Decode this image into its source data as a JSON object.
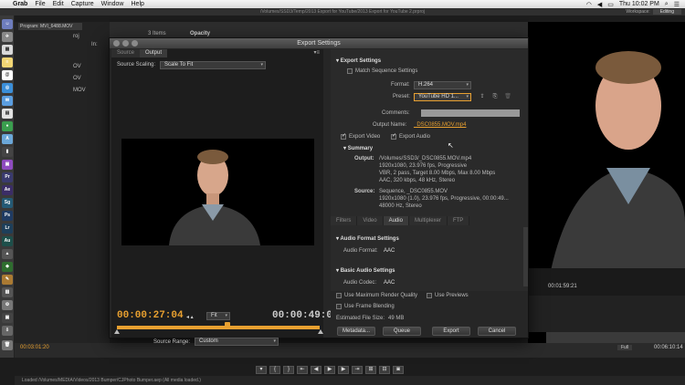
{
  "menubar": {
    "app": "Grab",
    "items": [
      "File",
      "Edit",
      "Capture",
      "Window",
      "Help"
    ],
    "clock": "Thu 10:02 PM"
  },
  "app_title": "/Volumes/SSD3/Temp/2013 Export for YouTube/2013 Export for YouTube 2.prproj",
  "workspace": {
    "label": "Workspace:",
    "value": "Editing"
  },
  "background": {
    "program_tab": "Program: MVI_6488.MOV",
    "items_count": "3 Items",
    "opacity_label": "Opacity",
    "in_label": "In:",
    "proj_label": "roj",
    "list_labels": [
      "OV",
      "OV",
      "MOV"
    ],
    "timecode_left": "00:03:01:20",
    "fit_bottom": "Full",
    "timecode_right_bottom": "00:06:10:14",
    "right_tc": "00:01:59:21",
    "status": "Loaded /Volumes/MEDIA/Videos/2013 Bumper/CJPhoto Bumper.aep (All media loaded.)"
  },
  "dialog": {
    "title": "Export Settings",
    "tabs": [
      "Source",
      "Output"
    ],
    "source_scaling_label": "Source Scaling:",
    "source_scaling_value": "Scale To Fit",
    "current_timecode": "00:00:27:04",
    "duration_timecode": "00:00:49:09",
    "fit_value": "Fit",
    "source_range_label": "Source Range:",
    "source_range_value": "Custom",
    "export_settings_header": "Export Settings",
    "match_sequence_label": "Match Sequence Settings",
    "format_label": "Format:",
    "format_value": "H.264",
    "preset_label": "Preset:",
    "preset_value": "YouTube HD 1...",
    "comments_label": "Comments:",
    "output_name_label": "Output Name:",
    "output_name_value": "_DSC0855.MOV.mp4",
    "export_video_label": "Export Video",
    "export_audio_label": "Export Audio",
    "summary_header": "Summary",
    "output_key": "Output:",
    "output_lines": [
      "/Volumes/SSD3/_DSC0855.MOV.mp4",
      "1920x1080, 23.976 fps, Progressive",
      "VBR, 2 pass, Target 8.00 Mbps, Max 8.00 Mbps",
      "AAC, 320 kbps, 48 kHz, Stereo"
    ],
    "source_key": "Source:",
    "source_lines": [
      "Sequence, _DSC0855.MOV",
      "1920x1080 (1.0), 23.976 fps, Progressive, 00:00:49...",
      "48000 Hz, Stereo"
    ],
    "subtabs": [
      "Filters",
      "Video",
      "Audio",
      "Multiplexer",
      "FTP"
    ],
    "selected_subtab": "Audio",
    "audio_format_settings_header": "Audio Format Settings",
    "audio_format_label": "Audio Format:",
    "audio_format_value": "AAC",
    "basic_audio_header": "Basic Audio Settings",
    "audio_codec_label": "Audio Codec:",
    "audio_codec_value": "AAC",
    "use_max_render_label": "Use Maximum Render Quality",
    "use_previews_label": "Use Previews",
    "use_frame_blending_label": "Use Frame Blending",
    "estimated_size_label": "Estimated File Size:",
    "estimated_size_value": "49 MB",
    "buttons": {
      "metadata": "Metadata...",
      "queue": "Queue",
      "export": "Export",
      "cancel": "Cancel"
    }
  },
  "colors": {
    "accent_orange": "#e8a030",
    "panel_bg": "#262626"
  }
}
